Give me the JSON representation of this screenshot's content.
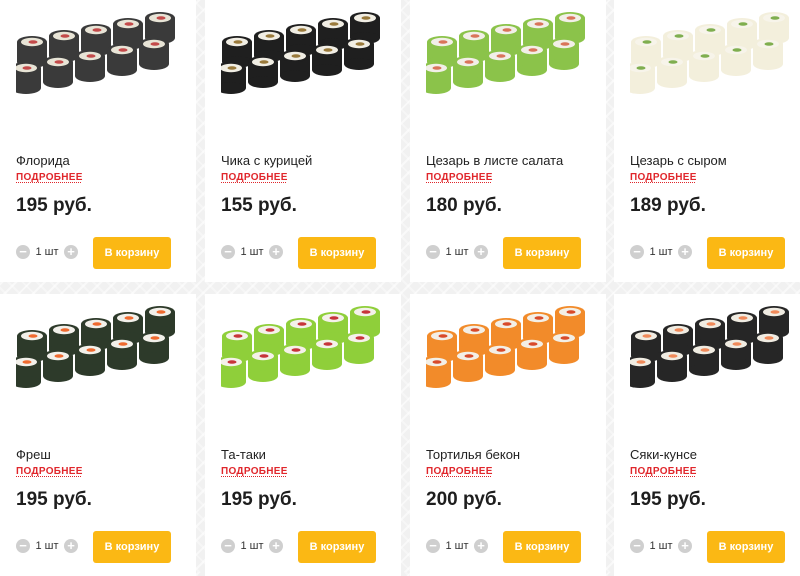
{
  "products": [
    {
      "name": "Флорида",
      "details": "ПОДРОБНЕЕ",
      "price": "195 руб.",
      "quantity": "1 шт",
      "cart_label": "В корзину",
      "image": "sushi-roll-florida",
      "roll_color": "#3a3a3a",
      "filling_color": "#e8e4d6",
      "accent_color": "#c34a4a"
    },
    {
      "name": "Чика с курицей",
      "details": "ПОДРОБНЕЕ",
      "price": "155 руб.",
      "quantity": "1 шт",
      "cart_label": "В корзину",
      "image": "sushi-roll-chicken",
      "roll_color": "#1f1f1f",
      "filling_color": "#f1eee4",
      "accent_color": "#9a7a3b"
    },
    {
      "name": "Цезарь в листе салата",
      "details": "ПОДРОБНЕЕ",
      "price": "180 руб.",
      "quantity": "1 шт",
      "cart_label": "В корзину",
      "image": "sushi-roll-caesar-lettuce",
      "roll_color": "#8bc34a",
      "filling_color": "#f2efe8",
      "accent_color": "#d9745a"
    },
    {
      "name": "Цезарь с сыром",
      "details": "ПОДРОБНЕЕ",
      "price": "189 руб.",
      "quantity": "1 шт",
      "cart_label": "В корзину",
      "image": "sushi-roll-caesar-cheese",
      "roll_color": "#f3efdc",
      "filling_color": "#f7f4ea",
      "accent_color": "#7fae4f"
    },
    {
      "name": "Фреш",
      "details": "ПОДРОБНЕЕ",
      "price": "195 руб.",
      "quantity": "1 шт",
      "cart_label": "В корзину",
      "image": "sushi-roll-fresh",
      "roll_color": "#2d3a2a",
      "filling_color": "#f2f0ea",
      "accent_color": "#ef6a2f"
    },
    {
      "name": "Та-таки",
      "details": "ПОДРОБНЕЕ",
      "price": "195 руб.",
      "quantity": "1 шт",
      "cart_label": "В корзину",
      "image": "sushi-roll-tataki",
      "roll_color": "#8fcf3a",
      "filling_color": "#f4f1ea",
      "accent_color": "#c7343a"
    },
    {
      "name": "Тортилья бекон",
      "details": "ПОДРОБНЕЕ",
      "price": "200 руб.",
      "quantity": "1 шт",
      "cart_label": "В корзину",
      "image": "sushi-roll-tortilla-bacon",
      "roll_color": "#f28b2a",
      "filling_color": "#f3efe6",
      "accent_color": "#d84a2a"
    },
    {
      "name": "Сяки-кунсе",
      "details": "ПОДРОБНЕЕ",
      "price": "195 руб.",
      "quantity": "1 шт",
      "cart_label": "В корзину",
      "image": "sushi-roll-syaki-kunse",
      "roll_color": "#262626",
      "filling_color": "#f0ece2",
      "accent_color": "#f08a5a"
    }
  ],
  "icons": {
    "minus": "minus-icon",
    "plus": "plus-icon"
  }
}
